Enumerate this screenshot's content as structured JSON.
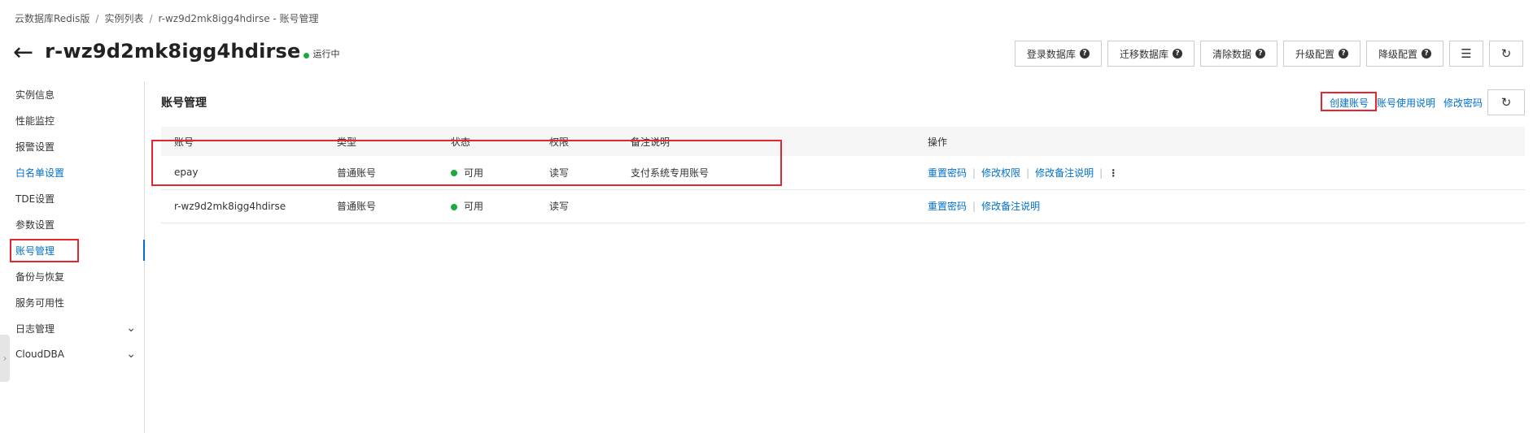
{
  "breadcrumb": [
    "云数据库Redis版",
    "实例列表",
    "r-wz9d2mk8igg4hdirse - 账号管理"
  ],
  "breadcrumb_sep": "/",
  "header": {
    "title": "r-wz9d2mk8igg4hdirse",
    "status": "运行中"
  },
  "toolbar": {
    "login_db": "登录数据库",
    "migrate_db": "迁移数据库",
    "clear_data": "清除数据",
    "upgrade": "升级配置",
    "downgrade": "降级配置"
  },
  "sidebar": {
    "items": [
      {
        "label": "实例信息"
      },
      {
        "label": "性能监控"
      },
      {
        "label": "报警设置"
      },
      {
        "label": "白名单设置"
      },
      {
        "label": "TDE设置"
      },
      {
        "label": "参数设置"
      },
      {
        "label": "账号管理"
      },
      {
        "label": "备份与恢复"
      },
      {
        "label": "服务可用性"
      },
      {
        "label": "日志管理"
      },
      {
        "label": "CloudDBA"
      }
    ],
    "active": "账号管理"
  },
  "main": {
    "title": "账号管理",
    "links": {
      "create_account": "创建账号",
      "account_help": "账号使用说明",
      "change_password": "修改密码"
    }
  },
  "table": {
    "columns": [
      "账号",
      "类型",
      "状态",
      "权限",
      "备注说明",
      "操作"
    ],
    "rows": [
      {
        "account": "epay",
        "type": "普通账号",
        "status": "可用",
        "permission": "读写",
        "note": "支付系统专用账号",
        "ops": [
          "重置密码",
          "修改权限",
          "修改备注说明"
        ]
      },
      {
        "account": "r-wz9d2mk8igg4hdirse",
        "type": "普通账号",
        "status": "可用",
        "permission": "读写",
        "note": "",
        "ops": [
          "重置密码",
          "修改备注说明"
        ]
      }
    ]
  },
  "colors": {
    "accent": "#0070cc",
    "status_green": "#1aaa3f",
    "highlight_red": "#e4262e"
  }
}
